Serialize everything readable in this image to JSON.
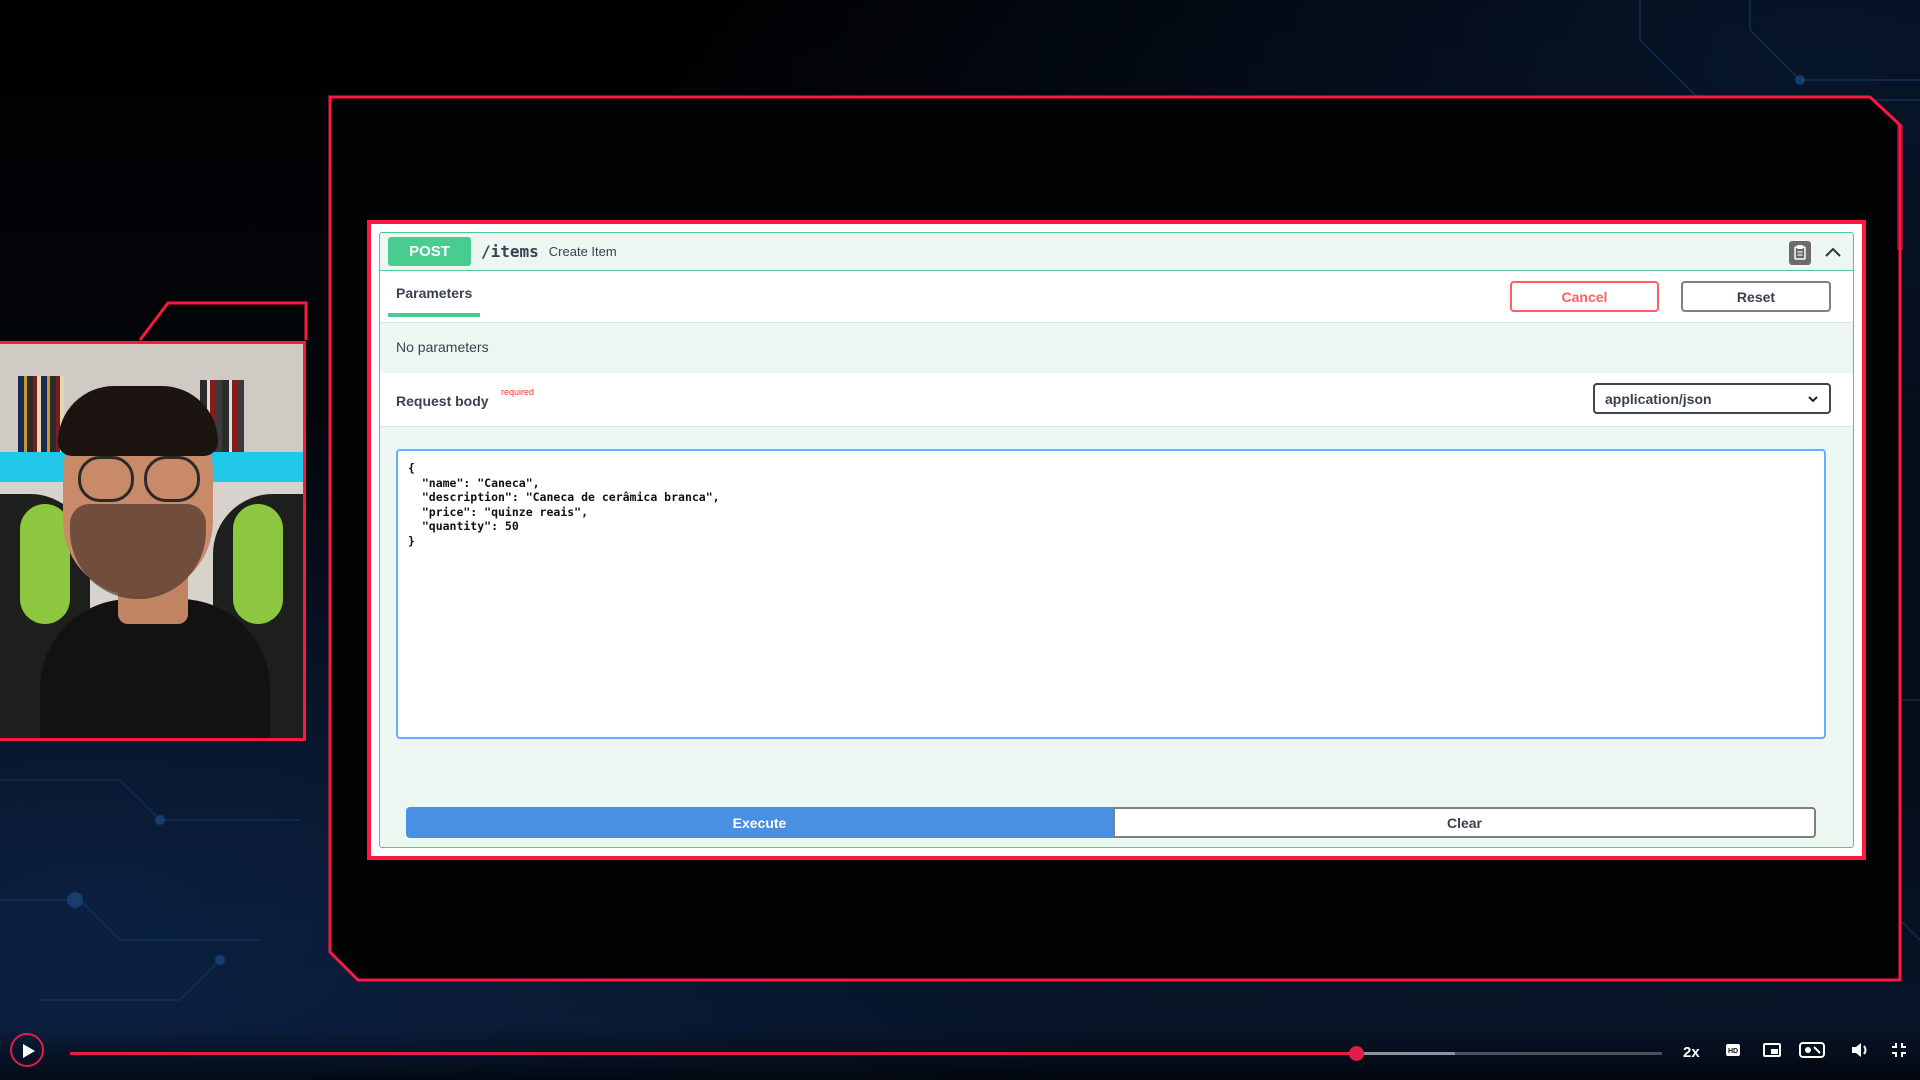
{
  "operation": {
    "method": "POST",
    "path": "/items",
    "summary": "Create Item"
  },
  "tabs": {
    "parameters": "Parameters",
    "cancel": "Cancel",
    "reset": "Reset"
  },
  "parameters": {
    "empty_text": "No parameters"
  },
  "request_body": {
    "label": "Request body",
    "required": "required",
    "content_type": "application/json",
    "value": "{\n  \"name\": \"Caneca\",\n  \"description\": \"Caneca de cerâmica branca\",\n  \"price\": \"quinze reais\",\n  \"quantity\": 50\n}"
  },
  "actions": {
    "execute": "Execute",
    "clear": "Clear"
  },
  "player": {
    "speed": "2x",
    "progress": 0.808,
    "buffered": 0.87,
    "icons": [
      "play-icon",
      "hd-icon",
      "picture-in-picture-icon",
      "cast-icon",
      "volume-icon",
      "fullscreen-exit-icon"
    ]
  },
  "colors": {
    "frame_accent": "#ff1744",
    "post_green": "#49cc90",
    "execute_blue": "#4990e2",
    "cancel_red": "#ff6060"
  }
}
